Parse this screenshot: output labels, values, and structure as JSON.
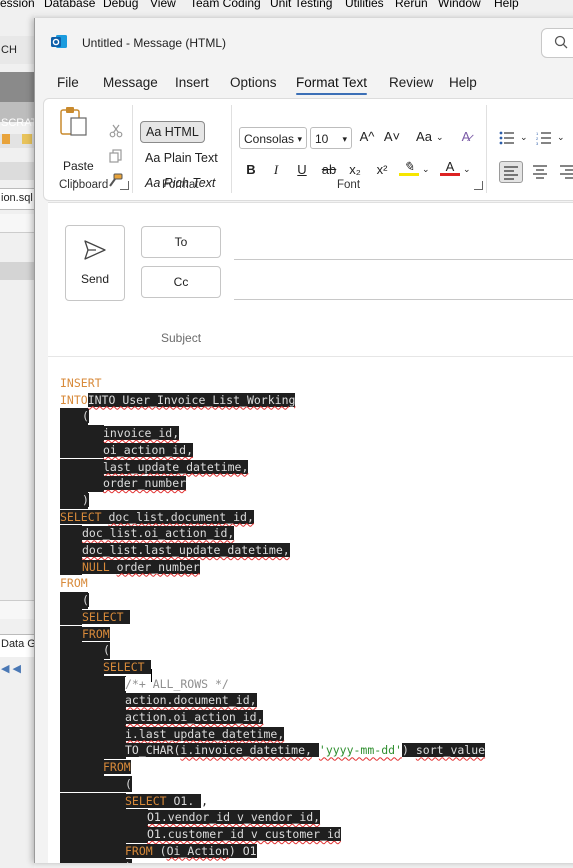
{
  "background_app": {
    "menu": [
      "ession",
      "Database",
      "Debug",
      "View",
      "Team Coding",
      "Unit Testing",
      "Utilities",
      "Rerun",
      "Window",
      "Help"
    ],
    "left_texts": [
      "CH",
      "SCRAT",
      "ion.sql",
      "Data G"
    ]
  },
  "window": {
    "title": "Untitled  -  Message (HTML)"
  },
  "tabs": [
    "File",
    "Message",
    "Insert",
    "Options",
    "Format Text",
    "Review",
    "Help"
  ],
  "active_tab": "Format Text",
  "ribbon": {
    "clipboard": {
      "paste": "Paste",
      "label": "Clipboard"
    },
    "format": {
      "html": "Aa HTML",
      "plain": "Aa Plain Text",
      "rich": "Aa Rich Text",
      "label": "Format"
    },
    "font": {
      "family": "Consolas",
      "size": "10",
      "grow": "A^",
      "shrink": "A˅",
      "case": "Aa",
      "bold": "B",
      "italic": "I",
      "underline": "U",
      "strike": "ab",
      "sub": "x₂",
      "sup": "x²",
      "label": "Font"
    }
  },
  "compose": {
    "send": "Send",
    "to": "To",
    "cc": "Cc",
    "subject": "Subject"
  },
  "code_lines": [
    "INSERT",
    "INTO User_Invoice_List_Working",
    "(",
    "invoice_id,",
    "oi_action_id,",
    "last_update_datetime,",
    "order_number",
    ")",
    "SELECT doc_list.document_id,",
    "doc_list.oi_action_id,",
    "doc_list.last_update_datetime,",
    "NULL order_number",
    "FROM",
    "(",
    "SELECT",
    "FROM",
    "(",
    "SELECT",
    "/*+ ALL_ROWS */",
    "action.document_id,",
    "action.oi_action_id,",
    "i.last_update_datetime,",
    "TO_CHAR(i.invoice_datetime, 'yyyy-mm-dd') sort_value",
    "FROM",
    "(",
    "SELECT O1. ,",
    "O1.vendor_id v_vendor_id,",
    "O1.customer_id v_customer_id",
    "FROM (Oi_Action) O1",
    ")"
  ],
  "colors": {
    "accent": "#3b6fb6",
    "keyword": "#d88a3a",
    "string": "#2f8f2f",
    "selection": "#1f1f1f"
  }
}
